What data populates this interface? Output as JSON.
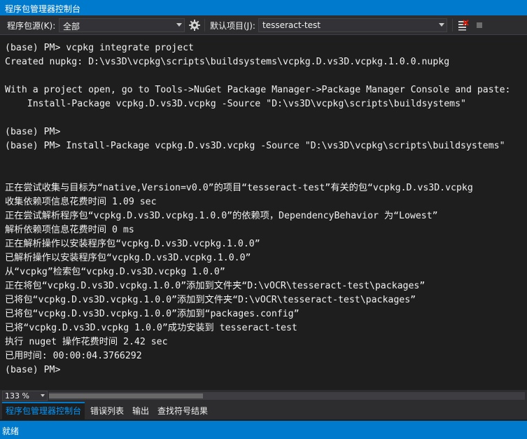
{
  "window": {
    "title": "程序包管理器控制台"
  },
  "toolbar": {
    "source_label": "程序包源(K):",
    "source_value": "全部",
    "settings_icon": "gear-icon",
    "project_label": "默认项目(J):",
    "project_value": "tesseract-test",
    "clear_icon": "clear-console-icon",
    "stop_icon": "stop-icon"
  },
  "console": {
    "lines": [
      "(base) PM> vcpkg integrate project",
      "Created nupkg: D:\\vs3D\\vcpkg\\scripts\\buildsystems\\vcpkg.D.vs3D.vcpkg.1.0.0.nupkg",
      "",
      "With a project open, go to Tools->NuGet Package Manager->Package Manager Console and paste:",
      "    Install-Package vcpkg.D.vs3D.vcpkg -Source \"D:\\vs3D\\vcpkg\\scripts\\buildsystems\"",
      "",
      "(base) PM>",
      "(base) PM> Install-Package vcpkg.D.vs3D.vcpkg -Source \"D:\\vs3D\\vcpkg\\scripts\\buildsystems\"",
      "",
      "",
      "正在尝试收集与目标为“native,Version=v0.0”的项目“tesseract-test”有关的包“vcpkg.D.vs3D.vcpkg",
      "收集依赖项信息花费时间 1.09 sec",
      "正在尝试解析程序包“vcpkg.D.vs3D.vcpkg.1.0.0”的依赖项，DependencyBehavior 为“Lowest”",
      "解析依赖项信息花费时间 0 ms",
      "正在解析操作以安装程序包“vcpkg.D.vs3D.vcpkg.1.0.0”",
      "已解析操作以安装程序包“vcpkg.D.vs3D.vcpkg.1.0.0”",
      "从“vcpkg”检索包“vcpkg.D.vs3D.vcpkg 1.0.0”",
      "正在将包“vcpkg.D.vs3D.vcpkg.1.0.0”添加到文件夹“D:\\vOCR\\tesseract-test\\packages”",
      "已将包“vcpkg.D.vs3D.vcpkg.1.0.0”添加到文件夹“D:\\vOCR\\tesseract-test\\packages”",
      "已将包“vcpkg.D.vs3D.vcpkg.1.0.0”添加到“packages.config”",
      "已将“vcpkg.D.vs3D.vcpkg 1.0.0”成功安装到 tesseract-test",
      "执行 nuget 操作花费时间 2.42 sec",
      "已用时间: 00:00:04.3766292",
      "(base) PM>"
    ]
  },
  "zoom": {
    "value": "133 %"
  },
  "tabs": [
    {
      "label": "程序包管理器控制台",
      "active": true
    },
    {
      "label": "错误列表",
      "active": false
    },
    {
      "label": "输出",
      "active": false
    },
    {
      "label": "查找符号结果",
      "active": false
    }
  ],
  "status": {
    "text": "就绪"
  },
  "colors": {
    "accent": "#007acc",
    "background": "#1e1e1e",
    "chrome": "#2d2d30",
    "active_tab_text": "#0097fb"
  }
}
